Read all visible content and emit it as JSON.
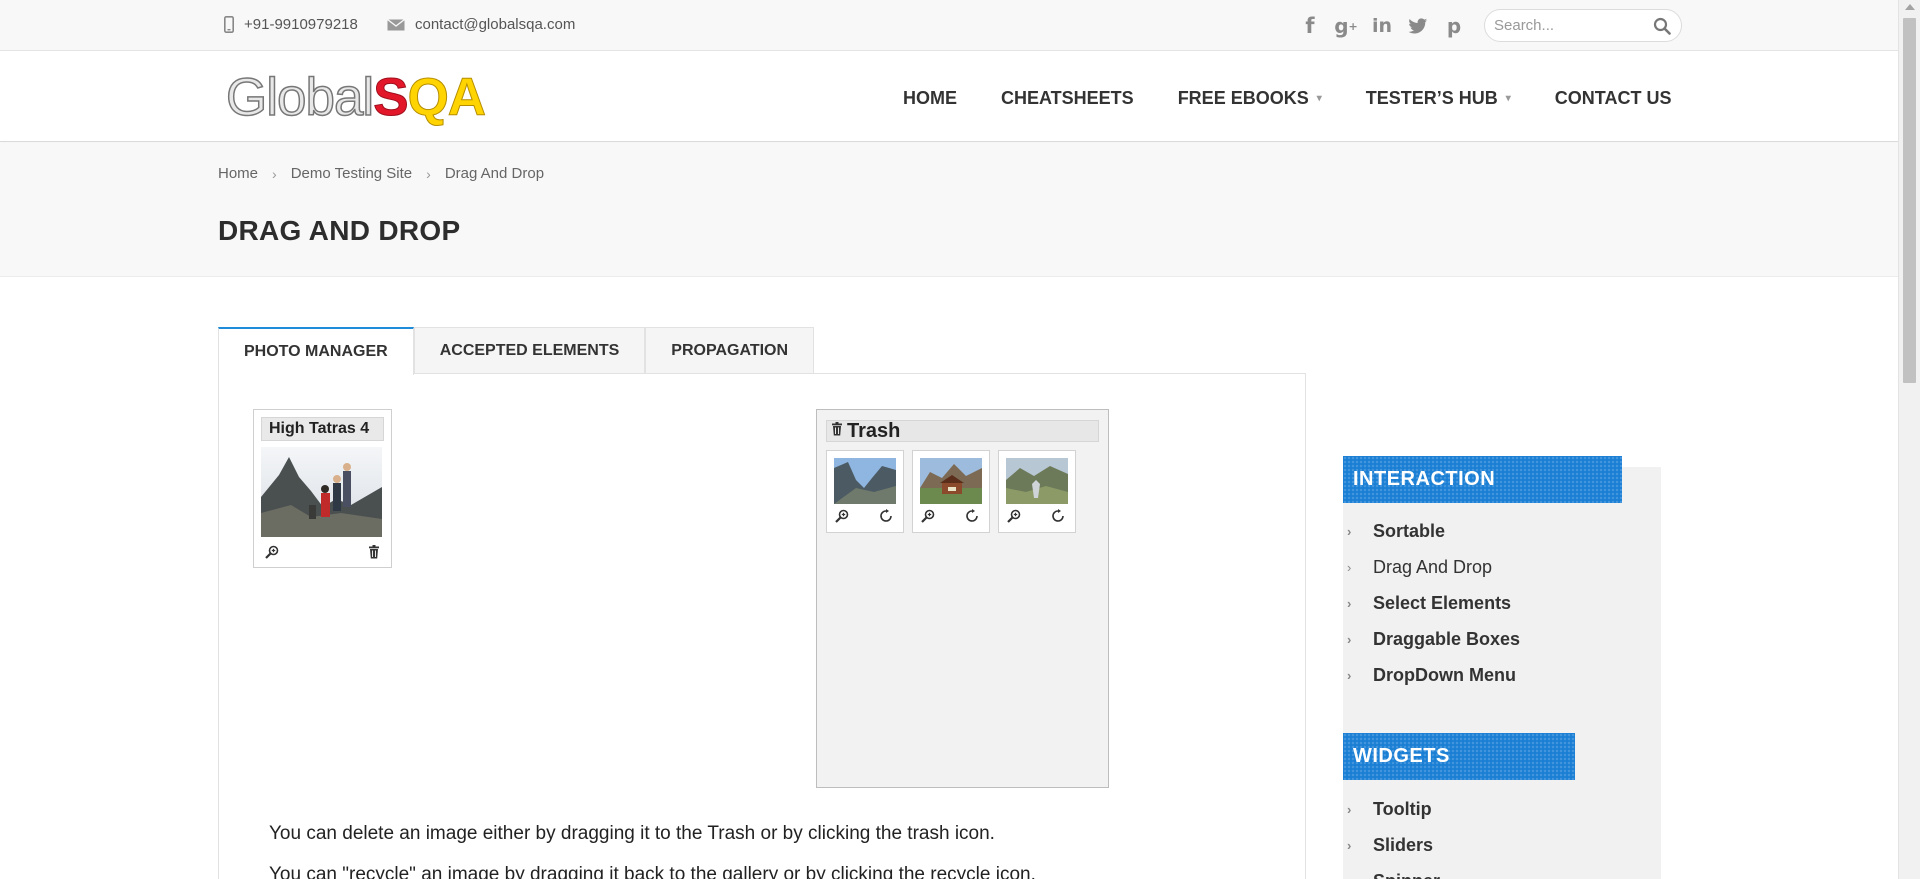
{
  "topbar": {
    "phone": "+91-9910979218",
    "email": "contact@globalsqa.com",
    "social_icons": [
      "facebook-icon",
      "google-plus-icon",
      "linkedin-icon",
      "twitter-icon",
      "pinterest-icon"
    ],
    "search_placeholder": "Search..."
  },
  "logo": {
    "part1": "Global",
    "part2": "S",
    "part3": "QA"
  },
  "nav": {
    "home": "HOME",
    "cheatsheets": "CHEATSHEETS",
    "free_ebooks": "FREE EBOOKS",
    "testers_hub": "TESTER’S HUB",
    "contact_us": "CONTACT US"
  },
  "breadcrumb": {
    "home": "Home",
    "demo": "Demo Testing Site",
    "current": "Drag And Drop"
  },
  "page_title": "DRAG AND DROP",
  "tabs": [
    "PHOTO MANAGER",
    "ACCEPTED ELEMENTS",
    "PROPAGATION"
  ],
  "gallery": {
    "card_title": "High Tatras 4"
  },
  "trash": {
    "label": "Trash",
    "item_count": 3
  },
  "instructions": {
    "line1": "You can delete an image either by dragging it to the Trash or by clicking the trash icon.",
    "line2": "You can \"recycle\" an image by dragging it back to the gallery or by clicking the recycle icon."
  },
  "sidebar": {
    "interaction_heading": "INTERACTION",
    "interaction_items": [
      "Sortable",
      "Drag And Drop",
      "Select Elements",
      "Draggable Boxes",
      "DropDown Menu"
    ],
    "widgets_heading": "WIDGETS",
    "widgets_items": [
      "Tooltip",
      "Sliders",
      "Spinner"
    ]
  },
  "colors": {
    "accent": "#1e8cd8",
    "sidebar_heading": "#1a7fd4",
    "logo_red": "#e3172a",
    "logo_yellow": "#ffd400"
  }
}
